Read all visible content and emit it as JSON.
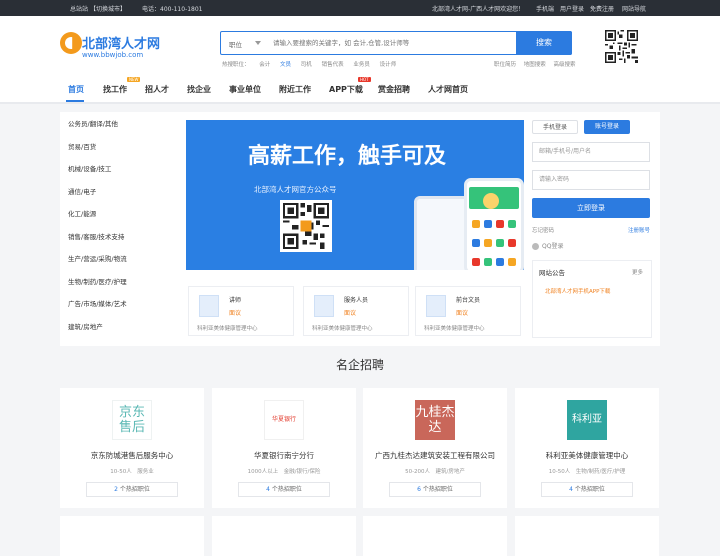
{
  "topbar": {
    "site": "总站站",
    "switch_city": "【切换城市】",
    "phone": "电话：400-110-1801",
    "welcome": "北部湾人才网-广西人才网欢迎您！",
    "links": [
      "手机端",
      "用户登录",
      "免费注册",
      "网站导航"
    ]
  },
  "logo": {
    "name": "北部湾人才网",
    "url_text": "www.bbwjob.com"
  },
  "search": {
    "category": "职位",
    "placeholder": "请输入要搜索的关键字，如 会计,仓管,设计师等",
    "button": "搜索"
  },
  "hot": {
    "label": "热搜职位：",
    "items": [
      "会计",
      "文员",
      "司机",
      "销售代表",
      "业务员",
      "设计师"
    ],
    "highlight_index": 1
  },
  "header_links": [
    "职位简历",
    "地图搜索",
    "高级搜索"
  ],
  "nav": {
    "items": [
      "首页",
      "找工作",
      "招人才",
      "找企业",
      "事业单位",
      "附近工作",
      "APP下载",
      "赏金招聘",
      "人才网首页"
    ],
    "active_index": 0,
    "badges": {
      "new": "NEW",
      "hot": "HOT"
    },
    "colors": {
      "accent": "#2c7be0",
      "new_badge": "#f5a623",
      "hot_badge": "#e8382b"
    }
  },
  "categories": [
    "公务员/翻译/其他",
    "贸易/百货",
    "机械/设备/技工",
    "通信/电子",
    "化工/能源",
    "销售/客服/技术支持",
    "生产/营运/采购/物流",
    "生物/制药/医疗/护理",
    "广告/市场/媒体/艺术",
    "建筑/房地产"
  ],
  "banner": {
    "title": "高薪工作，触手可及",
    "subtitle": "北部湾人才网官方公众号"
  },
  "featured_jobs": [
    {
      "title": "讲师",
      "salary": "面议",
      "company": "科利亚美体健康管理中心"
    },
    {
      "title": "服务人员",
      "salary": "面议",
      "company": "科利亚美体健康管理中心"
    },
    {
      "title": "前台文员",
      "salary": "面议",
      "company": "科利亚美体健康管理中心"
    }
  ],
  "login": {
    "tab_mobile": "手机登录",
    "tab_account": "账号登录",
    "username_placeholder": "邮箱/手机号/用户名",
    "password_placeholder": "请输入密码",
    "submit": "立即登录",
    "forgot": "忘记密码",
    "register": "注册账号",
    "qq": "QQ登录"
  },
  "notice": {
    "title": "网站公告",
    "more": "更多",
    "items": [
      "北部湾人才网手机APP下载"
    ]
  },
  "famous": {
    "title": "名企招聘",
    "companies": [
      {
        "logo_text": "京东售后",
        "logo_color": "#5bb8b4",
        "name": "京东防城港售后服务中心",
        "info": "10-50人　服务业",
        "hot_count": "2",
        "hot_suffix": " 个热招职位"
      },
      {
        "logo_text": "华夏银行",
        "logo_color": "#e23a2c",
        "name": "华夏银行南宁分行",
        "info": "1000人以上　金融/银行/保险",
        "hot_count": "4",
        "hot_suffix": " 个热招职位"
      },
      {
        "logo_text": "九桂杰达",
        "logo_color": "#c9675a",
        "name": "广西九桂杰达建筑安装工程有限公司",
        "info": "50-200人　建筑/房地产",
        "hot_count": "6",
        "hot_suffix": " 个热招职位"
      },
      {
        "logo_text": "科利亚",
        "logo_color": "#2fa5a0",
        "name": "科利亚美体健康管理中心",
        "info": "10-50人　生物/制药/医疗/护理",
        "hot_count": "4",
        "hot_suffix": " 个热招职位"
      }
    ]
  }
}
